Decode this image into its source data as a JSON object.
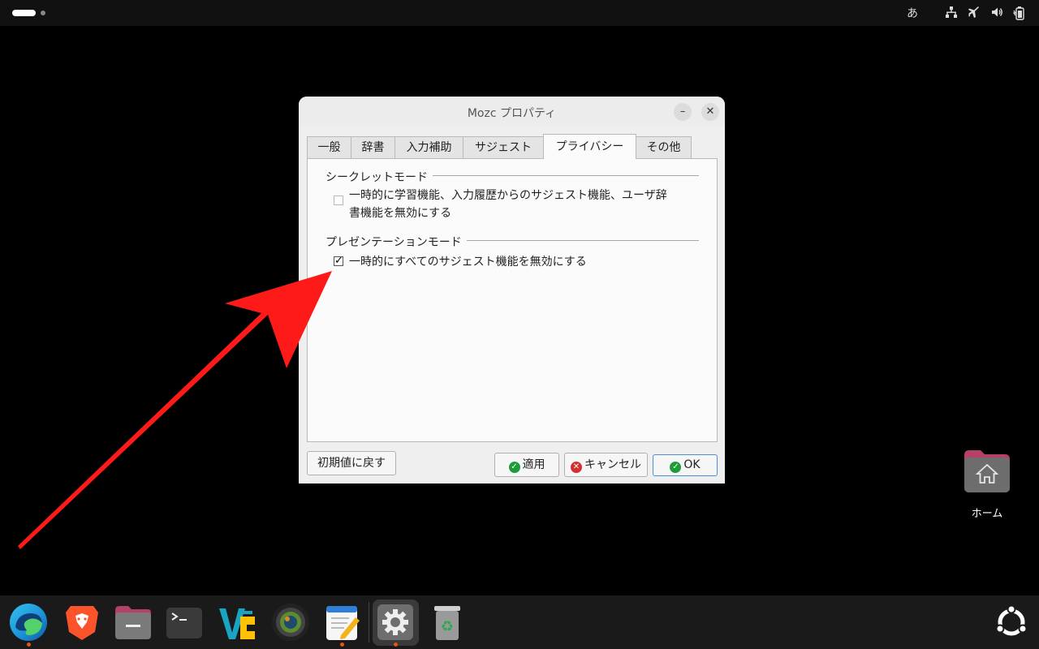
{
  "topbar": {
    "ime_indicator": "あ",
    "icons": [
      "network-icon",
      "airplane-mode-icon",
      "volume-icon",
      "battery-icon"
    ]
  },
  "dialog": {
    "title": "Mozc プロパティ",
    "tabs": [
      {
        "label": "一般",
        "active": false
      },
      {
        "label": "辞書",
        "active": false
      },
      {
        "label": "入力補助",
        "active": false
      },
      {
        "label": "サジェスト",
        "active": false
      },
      {
        "label": "プライバシー",
        "active": true
      },
      {
        "label": "その他",
        "active": false
      }
    ],
    "secret_mode": {
      "title": "シークレットモード",
      "checkbox_label_line1": "一時的に学習機能、入力履歴からのサジェスト機能、ユーザ辞",
      "checkbox_label_line2": "書機能を無効にする",
      "checked": false
    },
    "presentation_mode": {
      "title": "プレゼンテーションモード",
      "checkbox_label": "一時的にすべてのサジェスト機能を無効にする",
      "checked": true
    },
    "buttons": {
      "reset": "初期値に戻す",
      "apply": "適用",
      "cancel": "キャンセル",
      "ok": "OK"
    }
  },
  "desktop": {
    "home_label": "ホーム"
  },
  "dock": {
    "apps": [
      "edge-browser",
      "brave-browser",
      "files",
      "terminal",
      "vscode-like-editor",
      "camera-lens-app",
      "text-editor",
      "settings",
      "trash"
    ]
  },
  "colors": {
    "arrow": "#ff1a1a",
    "accent": "#4d8fd6",
    "ok_green": "#1e9c3a",
    "cancel_red": "#d22f2f"
  }
}
